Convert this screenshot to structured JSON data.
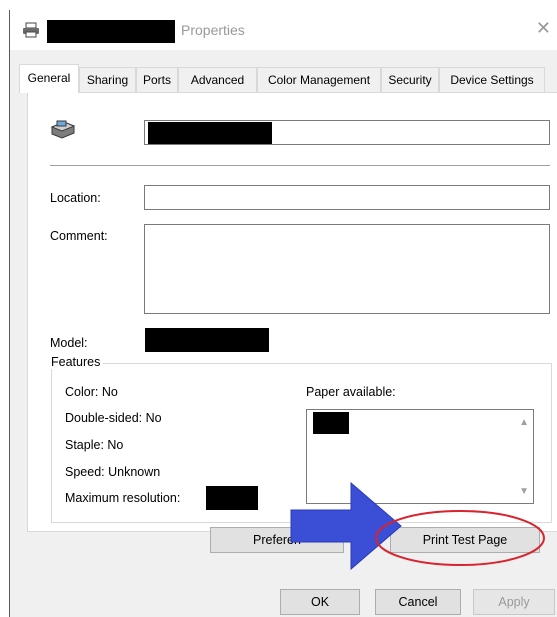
{
  "window": {
    "title": "Properties"
  },
  "tabs": [
    {
      "label": "General"
    },
    {
      "label": "Sharing"
    },
    {
      "label": "Ports"
    },
    {
      "label": "Advanced"
    },
    {
      "label": "Color Management"
    },
    {
      "label": "Security"
    },
    {
      "label": "Device Settings"
    }
  ],
  "general": {
    "location_label": "Location:",
    "location_value": "",
    "comment_label": "Comment:",
    "comment_value": "",
    "model_label": "Model:"
  },
  "features": {
    "legend": "Features",
    "color": "Color: No",
    "double_sided": "Double-sided: No",
    "staple": "Staple: No",
    "speed": "Speed: Unknown",
    "max_resolution": "Maximum resolution:",
    "paper_label": "Paper available:"
  },
  "buttons": {
    "preferences": "Preferen",
    "print_test_page": "Print Test Page",
    "ok": "OK",
    "cancel": "Cancel",
    "apply": "Apply"
  },
  "colors": {
    "annotation_arrow": "#3a4fd6",
    "annotation_ellipse": "#d9232e"
  }
}
